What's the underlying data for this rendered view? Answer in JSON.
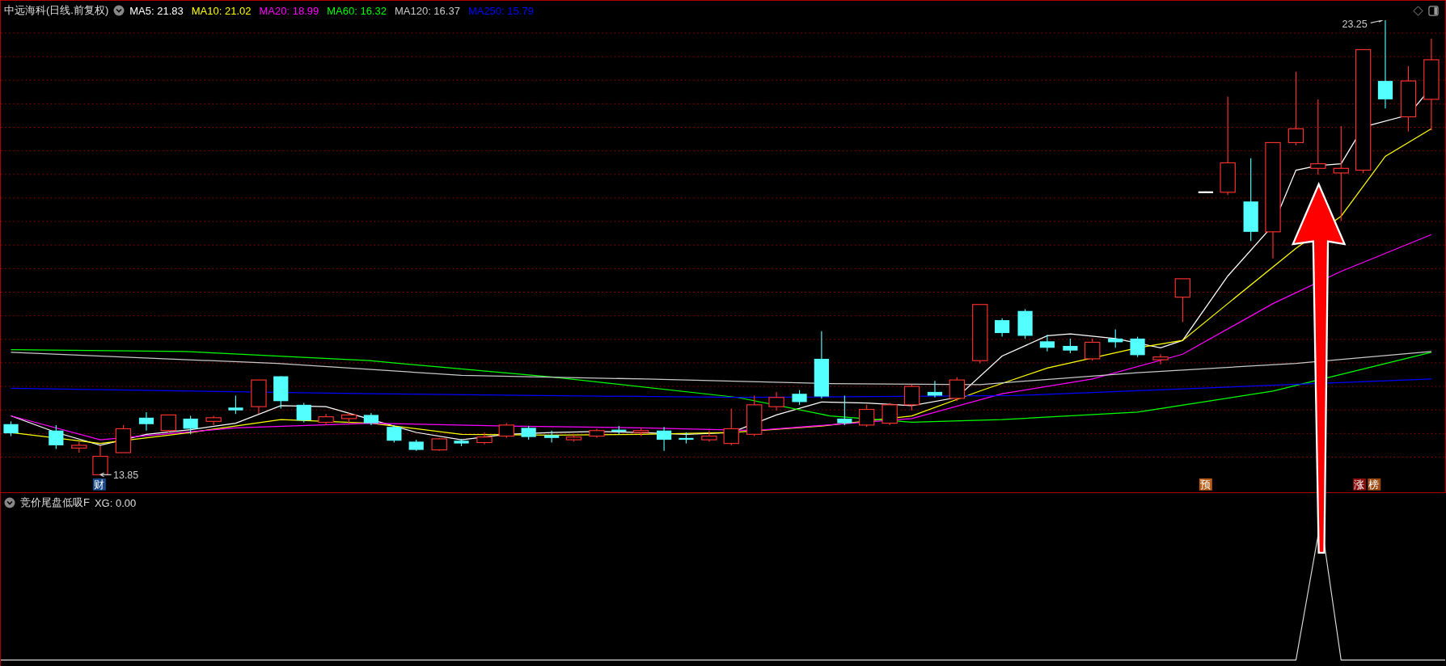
{
  "chart_header": {
    "title": "中远海科(日线.前复权)",
    "moving_averages": [
      {
        "label": "MA5:",
        "value": "21.83",
        "color": "#ffffff"
      },
      {
        "label": "MA10:",
        "value": "21.02",
        "color": "#ffff00"
      },
      {
        "label": "MA20:",
        "value": "18.99",
        "color": "#ff00ff"
      },
      {
        "label": "MA60:",
        "value": "16.32",
        "color": "#00ff00"
      },
      {
        "label": "MA120:",
        "value": "16.37",
        "color": "#c8c8c8"
      },
      {
        "label": "MA250:",
        "value": "15.79",
        "color": "#0000ff"
      }
    ]
  },
  "price_chart": {
    "high_label": "23.25",
    "low_label": "13.85",
    "event_markers": [
      {
        "text": "财",
        "color": "#1a4a8a"
      },
      {
        "text": "预",
        "color": "#b85a14"
      },
      {
        "text": "涨",
        "color": "#8a1010"
      },
      {
        "text": "榜",
        "color": "#9a4a10"
      }
    ]
  },
  "indicator_panel": {
    "name": "竞价尾盘低吸F",
    "reading": "XG: 0.00"
  }
}
